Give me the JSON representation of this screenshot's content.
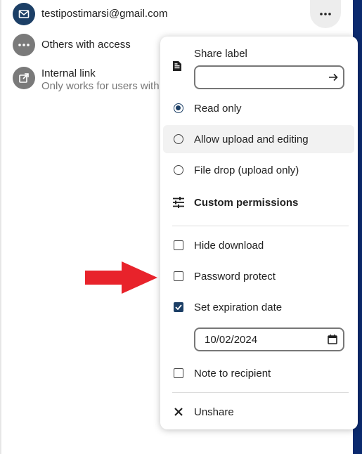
{
  "share_rows": [
    {
      "label": "testipostimarsi@gmail.com",
      "icon": "email-icon"
    },
    {
      "label": "Others with access",
      "icon": "more-icon"
    },
    {
      "label": "Internal link",
      "sublabel": "Only works for users with",
      "icon": "external-link-icon"
    }
  ],
  "menu": {
    "share_label": "Share label",
    "share_label_value": "",
    "permissions": [
      {
        "label": "Read only",
        "checked": true
      },
      {
        "label": "Allow upload and editing",
        "checked": false
      },
      {
        "label": "File drop (upload only)",
        "checked": false
      }
    ],
    "custom_permissions": "Custom permissions",
    "options": [
      {
        "label": "Hide download",
        "checked": false
      },
      {
        "label": "Password protect",
        "checked": false
      },
      {
        "label": "Set expiration date",
        "checked": true
      },
      {
        "label": "Note to recipient",
        "checked": false
      }
    ],
    "expiration_date": "10/02/2024",
    "unshare": "Unshare"
  },
  "colors": {
    "accent": "#1c3f66",
    "sidebar_bar": "#0b2a6e",
    "annotation_arrow": "#e8232b"
  }
}
